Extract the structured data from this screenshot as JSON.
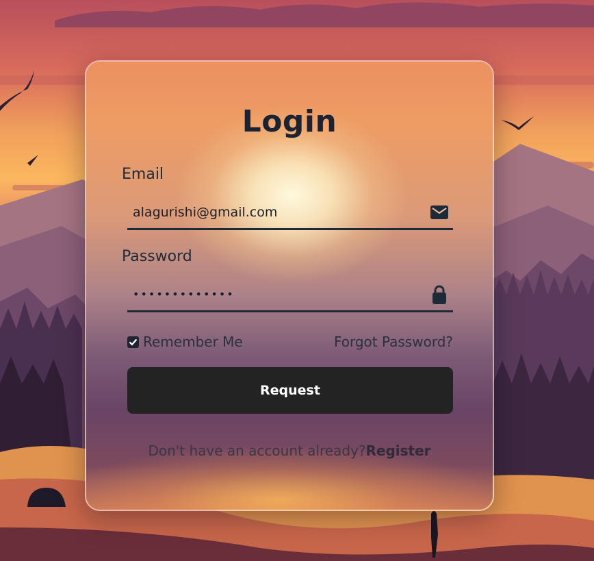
{
  "login": {
    "title": "Login",
    "email_label": "Email",
    "email_value": "alagurishi@gmail.com",
    "email_icon": "envelope-icon",
    "password_label": "Password",
    "password_value": "•••••••••••••",
    "password_icon": "lock-icon",
    "remember_label": "Remember Me",
    "remember_checked": true,
    "forgot_label": "Forgot Password?",
    "submit_label": "Request",
    "no_account_text": "Don't have an account already?",
    "register_label": "Register"
  },
  "colors": {
    "text_dark": "#1f2a38",
    "button_bg": "#232323",
    "button_text": "#ffffff",
    "sky_top": "#c2565a",
    "sky_glow": "#fbb45e"
  }
}
